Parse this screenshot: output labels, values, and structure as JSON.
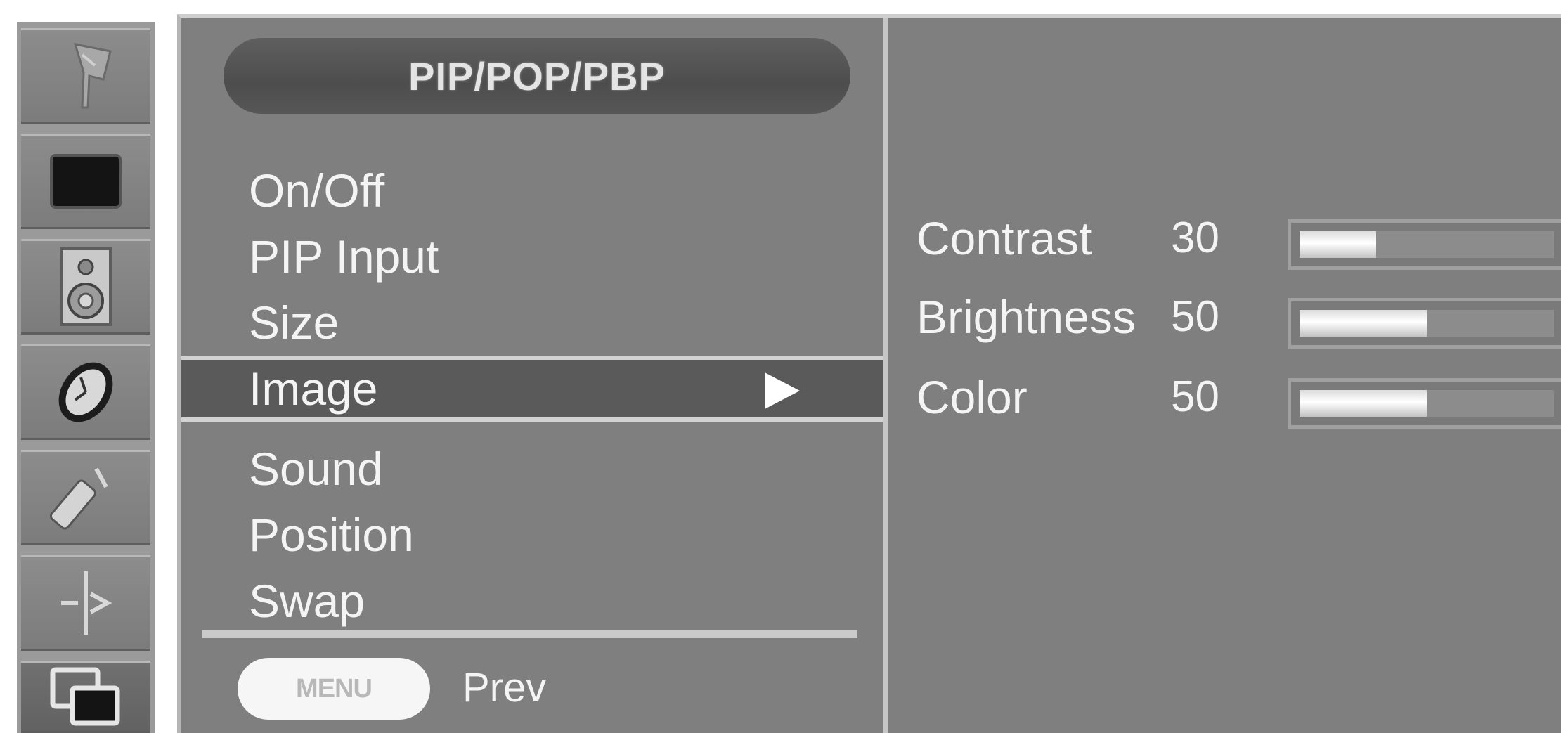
{
  "icon_strip": {
    "icons": [
      {
        "name": "antenna-icon"
      },
      {
        "name": "picture-icon"
      },
      {
        "name": "speaker-icon"
      },
      {
        "name": "clock-icon"
      },
      {
        "name": "key-icon"
      },
      {
        "name": "option-icon"
      },
      {
        "name": "pip-icon",
        "selected": true
      }
    ]
  },
  "menu": {
    "title": "PIP/POP/PBP",
    "items": [
      {
        "label": "On/Off"
      },
      {
        "label": "PIP Input"
      },
      {
        "label": "Size"
      },
      {
        "label": "Image",
        "selected": true
      },
      {
        "label": "Sound"
      },
      {
        "label": "Position"
      },
      {
        "label": "Swap"
      }
    ],
    "footer": {
      "menu_button": "MENU",
      "prev_label": "Prev"
    }
  },
  "settings": [
    {
      "label": "Contrast",
      "value": "30",
      "fraction": 0.3
    },
    {
      "label": "Brightness",
      "value": "50",
      "fraction": 0.5
    },
    {
      "label": "Color",
      "value": "50",
      "fraction": 0.5
    }
  ],
  "colors": {
    "panel_background": "#7f7f7f",
    "selected_row": "#5a5a5a",
    "text": "#f4f4f4"
  }
}
